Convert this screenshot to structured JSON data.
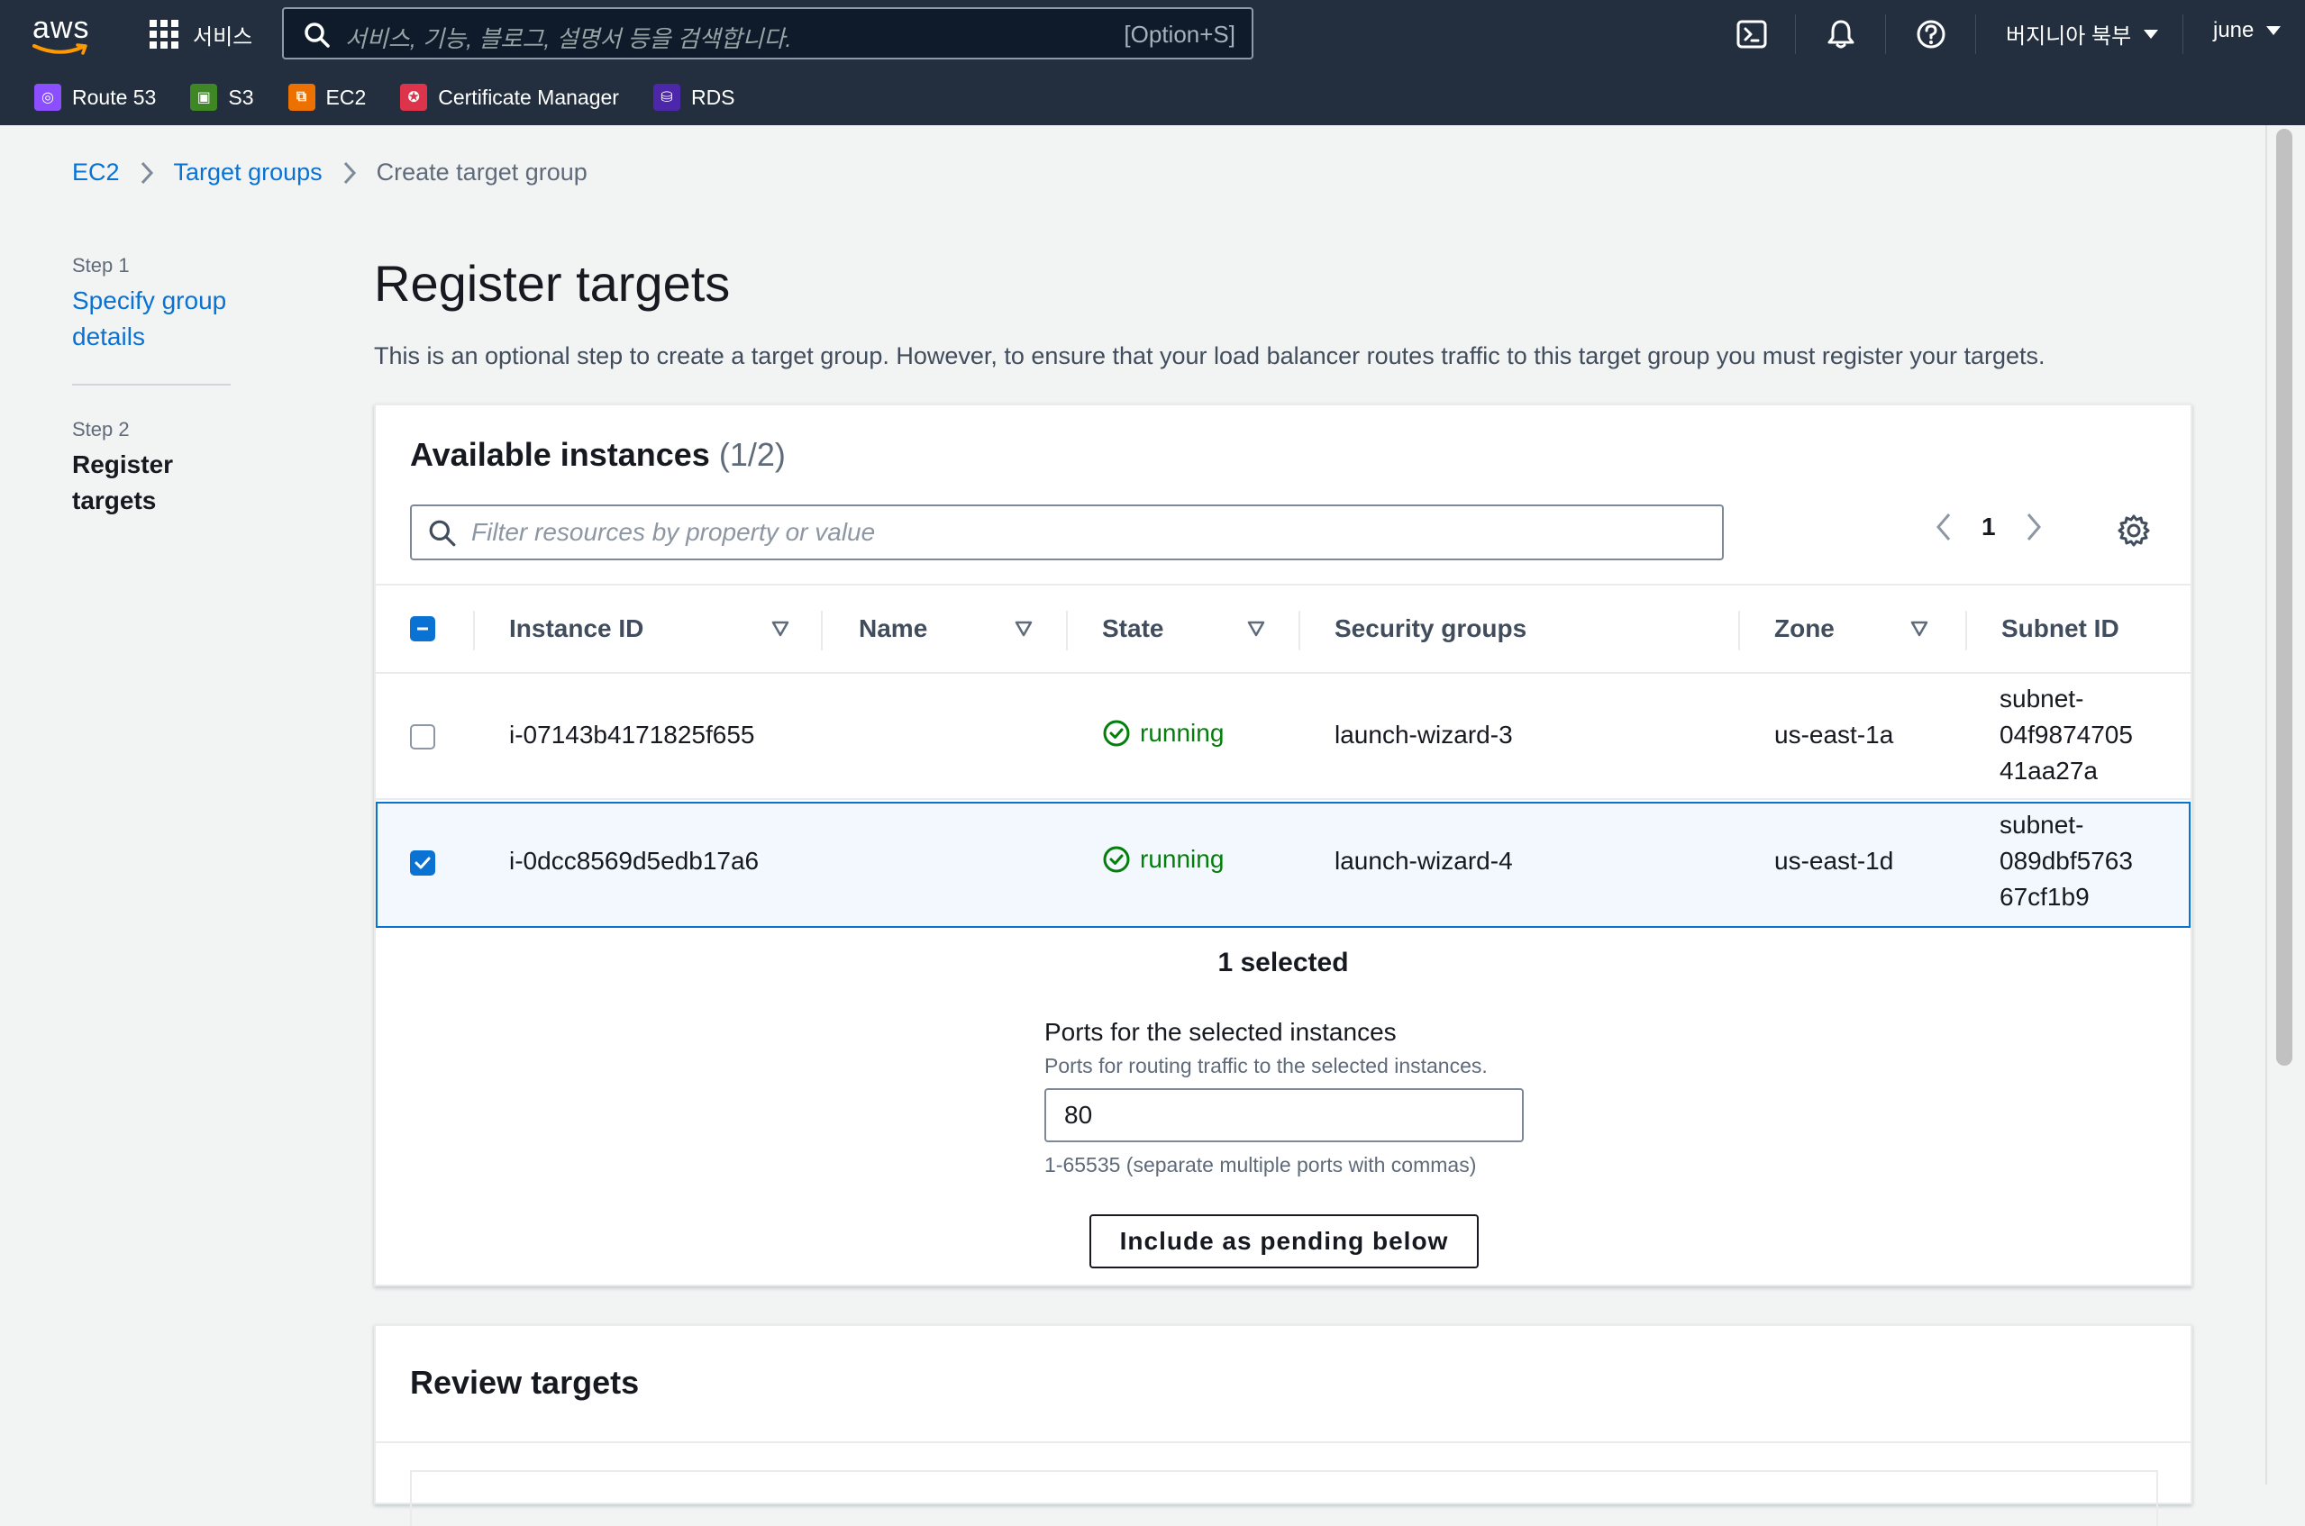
{
  "nav": {
    "logo": "aws",
    "services_label": "서비스",
    "search_placeholder": "서비스, 기능, 블로그, 설명서 등을 검색합니다.",
    "search_shortcut": "[Option+S]",
    "region": "버지니아 북부",
    "user": "june",
    "favorites": [
      {
        "label": "Route 53",
        "icon": "route53-icon",
        "color": "#8c4fff"
      },
      {
        "label": "S3",
        "icon": "s3-icon",
        "color": "#3f8624"
      },
      {
        "label": "EC2",
        "icon": "ec2-icon",
        "color": "#ed7100"
      },
      {
        "label": "Certificate Manager",
        "icon": "certificate-manager-icon",
        "color": "#dd344c"
      },
      {
        "label": "RDS",
        "icon": "rds-icon",
        "color": "#4d27aa"
      }
    ]
  },
  "breadcrumb": {
    "items": [
      "EC2",
      "Target groups",
      "Create target group"
    ]
  },
  "steps": [
    {
      "label": "Step 1",
      "title": "Specify group details"
    },
    {
      "label": "Step 2",
      "title": "Register targets"
    }
  ],
  "main": {
    "title": "Register targets",
    "description": "This is an optional step to create a target group. However, to ensure that your load balancer routes traffic to this target group you must register your targets."
  },
  "available": {
    "title": "Available instances",
    "count": "(1/2)",
    "filter_placeholder": "Filter resources by property or value",
    "page": "1",
    "columns": [
      "Instance ID",
      "Name",
      "State",
      "Security groups",
      "Zone",
      "Subnet ID"
    ],
    "rows": [
      {
        "selected": false,
        "instance_id": "i-07143b4171825f655",
        "name": "",
        "state": "running",
        "security_group": "launch-wizard-3",
        "zone": "us-east-1a",
        "subnet": [
          "subnet-",
          "04f9874705",
          "41aa27a"
        ]
      },
      {
        "selected": true,
        "instance_id": "i-0dcc8569d5edb17a6",
        "name": "",
        "state": "running",
        "security_group": "launch-wizard-4",
        "zone": "us-east-1d",
        "subnet": [
          "subnet-",
          "089dbf5763",
          "67cf1b9"
        ]
      }
    ],
    "selected_text": "1 selected",
    "ports_label": "Ports for the selected instances",
    "ports_description": "Ports for routing traffic to the selected instances.",
    "ports_value": "80",
    "ports_hint": "1-65535 (separate multiple ports with commas)",
    "include_button": "Include as pending below"
  },
  "review": {
    "title": "Review targets"
  },
  "colors": {
    "nav_bg": "#232f3e",
    "link": "#0972d3",
    "running": "#037f0c",
    "selected_row_bg": "#f2f8fd"
  }
}
